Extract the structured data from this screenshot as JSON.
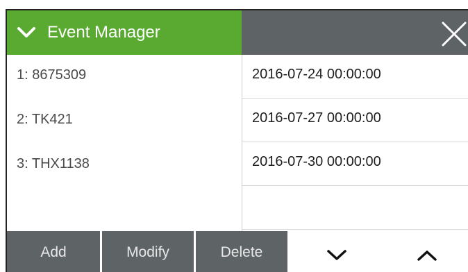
{
  "header": {
    "title": "Event Manager",
    "collapse_icon": "chevron-down-icon",
    "close_icon": "close-icon",
    "accent_color": "#5aaa32",
    "bar_color": "#5e6366"
  },
  "events": [
    {
      "label": "1: 8675309",
      "date": "2016-07-24 00:00:00"
    },
    {
      "label": "2: TK421",
      "date": "2016-07-27 00:00:00"
    },
    {
      "label": "3: THX1138",
      "date": "2016-07-30 00:00:00"
    }
  ],
  "footer": {
    "add_label": "Add",
    "modify_label": "Modify",
    "delete_label": "Delete",
    "down_icon": "chevron-down-icon",
    "up_icon": "chevron-up-icon"
  }
}
